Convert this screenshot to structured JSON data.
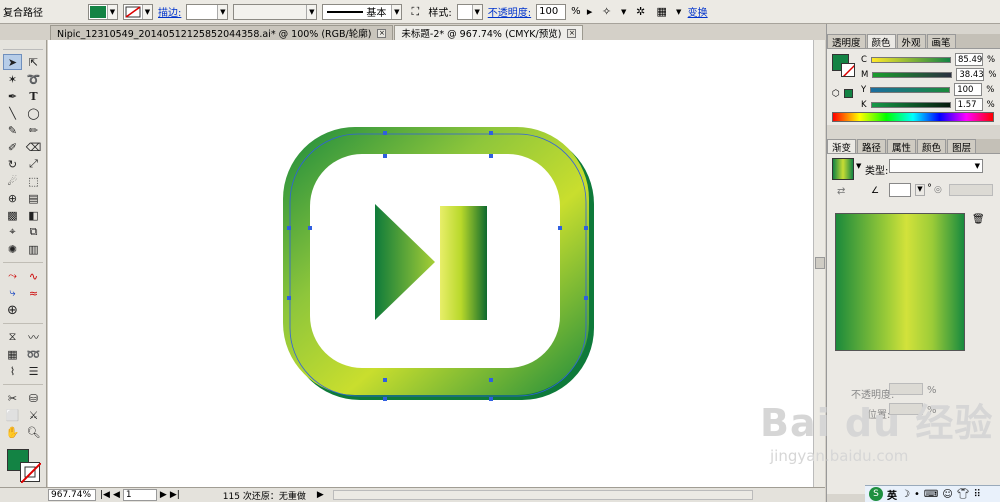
{
  "control": {
    "object_type": "复合路径",
    "stroke_link": "描边:",
    "brush_value": "基本",
    "style_label": "样式:",
    "opacity_link": "不透明度:",
    "opacity_value": "100",
    "opacity_unit": "%",
    "transform_link": "变换"
  },
  "tabs": [
    {
      "label": "Nipic_12310549_20140512125852044358.ai* @ 100% (RGB/轮廓)",
      "active": false
    },
    {
      "label": "未标题-2* @ 967.74% (CMYK/预览)",
      "active": true
    }
  ],
  "tab_close": "×",
  "status": {
    "zoom": "967.74%",
    "page": "1",
    "undo_text": "115 次还原：无重做",
    "play": "▶",
    "first": "|◀",
    "prev": "◀",
    "next": "▶",
    "last": "▶|"
  },
  "color_panel": {
    "tabs": [
      "透明度",
      "颜色",
      "外观",
      "画笔"
    ],
    "active_tab": "颜色",
    "channels": [
      {
        "name": "C",
        "value": "85.49",
        "unit": "%"
      },
      {
        "name": "M",
        "value": "38.43",
        "unit": "%"
      },
      {
        "name": "Y",
        "value": "100",
        "unit": "%"
      },
      {
        "name": "K",
        "value": "1.57",
        "unit": "%"
      }
    ],
    "fill_color": "#138344"
  },
  "gradient_panel": {
    "tabs": [
      "渐变",
      "路径",
      "属性",
      "颜色",
      "图层"
    ],
    "active_tab": "渐变",
    "type_label": "类型:",
    "type_value": "",
    "angle_unit": "°",
    "opacity_label": "不透明度:",
    "location_label": "位置:",
    "pct": "%"
  },
  "colors": {
    "frame_dark": "#0e7a3a",
    "frame_light": "#b7d92c",
    "accent_green": "#138344",
    "selection": "#2f5fe0"
  },
  "watermark": {
    "brand": "Bai du 经验",
    "url": "jingyan.baidu.com"
  },
  "taskbar": {
    "ime": "英"
  }
}
